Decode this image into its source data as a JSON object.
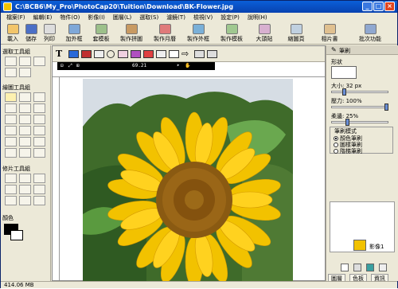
{
  "window": {
    "title": "C:\\BCB6\\My_Pro\\PhotoCap20\\Tuition\\Download\\BK-Flower.jpg"
  },
  "menu": [
    "檔案(F)",
    "編輯(E)",
    "物件(O)",
    "影像(I)",
    "圖層(L)",
    "選取(S)",
    "濾鏡(T)",
    "檢視(V)",
    "設定(P)",
    "說明(H)"
  ],
  "toolbar": [
    {
      "label": "載入",
      "icon": "open-icon"
    },
    {
      "label": "儲存",
      "icon": "save-icon"
    },
    {
      "label": "列印",
      "icon": "print-icon"
    },
    {
      "label": "加外框",
      "icon": "frame-icon"
    },
    {
      "label": "套模板",
      "icon": "template-icon"
    },
    {
      "label": "製作拼圖",
      "icon": "puzzle-icon"
    },
    {
      "label": "製作月曆",
      "icon": "calendar-icon"
    },
    {
      "label": "製作外框",
      "icon": "make-frame-icon"
    },
    {
      "label": "製作模板",
      "icon": "make-template-icon"
    },
    {
      "label": "大頭貼",
      "icon": "sticker-icon"
    },
    {
      "label": "縮圖頁",
      "icon": "thumbnail-icon"
    },
    {
      "label": "相片書",
      "icon": "photobook-icon"
    },
    {
      "label": "批次功能",
      "icon": "batch-icon"
    }
  ],
  "canvas": {
    "zoom": "69.21"
  },
  "left_panel": {
    "select_group": "選取工具組",
    "draw_group": "繪圖工具組",
    "retouch_group": "修片工具組",
    "color_label": "顏色"
  },
  "right_panel": {
    "title": "筆刷",
    "shape_label": "形狀",
    "size_label": "大小: 32 px",
    "pressure_label": "壓力: 100%",
    "feather_label": "柔邊: 25%",
    "mode_label": "筆刷模式",
    "mode_options": [
      "顏色筆刷",
      "圖樣筆刷",
      "階梯筆刷"
    ],
    "mode_selected": 0,
    "size_value": 0.2,
    "pressure_value": 1.0,
    "feather_value": 0.25,
    "thumb_label": "影像1",
    "tabs": [
      "圖層",
      "色板",
      "資訊"
    ]
  },
  "status": {
    "memory": "414.06 MB"
  },
  "colors": {
    "title": "#0842b0",
    "sunflower": "#f2c200",
    "center": "#8a5a12",
    "sky": "#d6dde4"
  }
}
